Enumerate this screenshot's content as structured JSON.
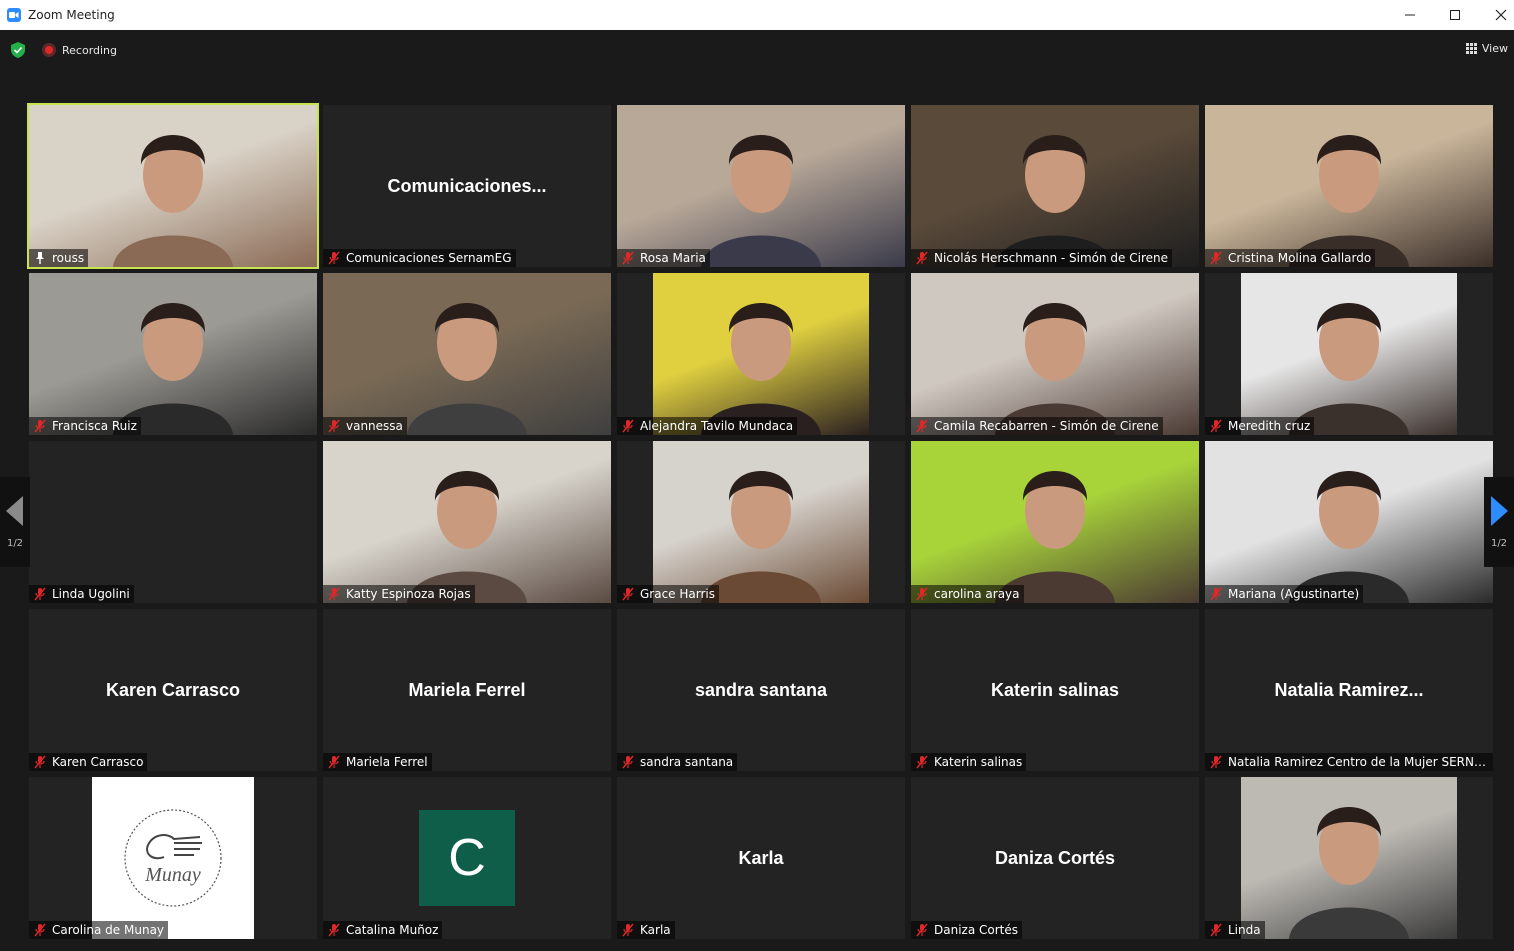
{
  "window": {
    "title": "Zoom Meeting"
  },
  "toolbar": {
    "recording_label": "Recording",
    "view_label": "View"
  },
  "pagination": {
    "left_page": "1/2",
    "right_page": "1/2"
  },
  "colors": {
    "active_speaker_border": "#c6e44e",
    "mic_muted": "#e02828",
    "avatar_c_bg": "#0e5e4a",
    "zoom_blue": "#2d8cff"
  },
  "participants": [
    {
      "name": "rouss",
      "video": true,
      "active": true,
      "mic": "pinned"
    },
    {
      "name": "Comunicaciones SernamEG",
      "center": "Comunicaciones...",
      "video": false
    },
    {
      "name": "Rosa Maria",
      "video": true
    },
    {
      "name": "Nicolás Herschmann - Simón de Cirene",
      "video": true
    },
    {
      "name": "Cristina Molina Gallardo",
      "video": true
    },
    {
      "name": "Francisca Ruiz",
      "video": true
    },
    {
      "name": "vannessa",
      "video": true
    },
    {
      "name": "Alejandra Tavilo Mundaca",
      "video": true
    },
    {
      "name": "Camila Recabarren - Simón de Cirene",
      "video": true
    },
    {
      "name": "Meredith cruz",
      "video": true
    },
    {
      "name": "Linda Ugolini",
      "video": false
    },
    {
      "name": "Katty Espinoza Rojas",
      "video": true
    },
    {
      "name": "Grace Harris",
      "video": true
    },
    {
      "name": "carolina araya",
      "video": true
    },
    {
      "name": "Mariana (Agustinarte)",
      "video": true
    },
    {
      "name": "Karen Carrasco",
      "center": "Karen Carrasco",
      "video": false
    },
    {
      "name": "Mariela Ferrel",
      "center": "Mariela Ferrel",
      "video": false
    },
    {
      "name": "sandra santana",
      "center": "sandra santana",
      "video": false
    },
    {
      "name": "Katerin salinas",
      "center": "Katerin salinas",
      "video": false
    },
    {
      "name": "Natalia Ramirez Centro de la Mujer SERNA...",
      "center": "Natalia  Ramirez...",
      "video": false
    },
    {
      "name": "Carolina de Munay",
      "logo": "Munay",
      "video": false
    },
    {
      "name": "Catalina Muñoz",
      "avatar_letter": "C",
      "video": false
    },
    {
      "name": "Karla",
      "center": "Karla",
      "video": false
    },
    {
      "name": "Daniza Cortés",
      "center": "Daniza Cortés",
      "video": false
    },
    {
      "name": "Linda",
      "video": true
    }
  ]
}
